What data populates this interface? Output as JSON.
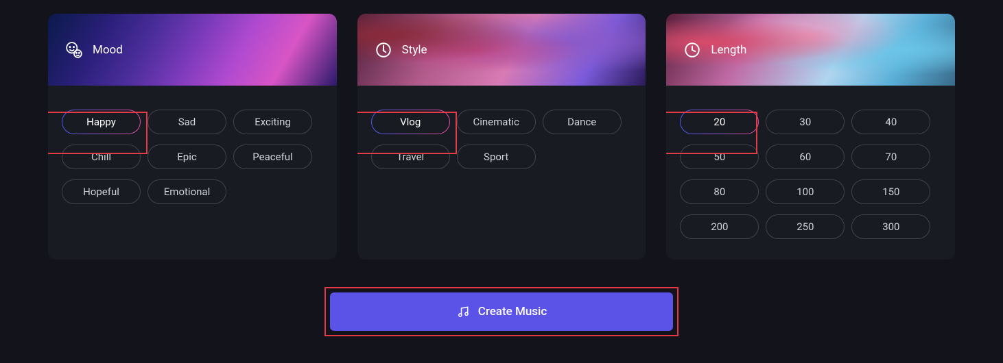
{
  "mood": {
    "title": "Mood",
    "options": [
      {
        "label": "Happy",
        "selected": true
      },
      {
        "label": "Sad",
        "selected": false
      },
      {
        "label": "Exciting",
        "selected": false
      },
      {
        "label": "Chill",
        "selected": false
      },
      {
        "label": "Epic",
        "selected": false
      },
      {
        "label": "Peaceful",
        "selected": false
      },
      {
        "label": "Hopeful",
        "selected": false
      },
      {
        "label": "Emotional",
        "selected": false
      }
    ]
  },
  "style": {
    "title": "Style",
    "options": [
      {
        "label": "Vlog",
        "selected": true
      },
      {
        "label": "Cinematic",
        "selected": false
      },
      {
        "label": "Dance",
        "selected": false
      },
      {
        "label": "Travel",
        "selected": false
      },
      {
        "label": "Sport",
        "selected": false
      }
    ]
  },
  "length": {
    "title": "Length",
    "options": [
      {
        "label": "20",
        "selected": true
      },
      {
        "label": "30",
        "selected": false
      },
      {
        "label": "40",
        "selected": false
      },
      {
        "label": "50",
        "selected": false
      },
      {
        "label": "60",
        "selected": false
      },
      {
        "label": "70",
        "selected": false
      },
      {
        "label": "80",
        "selected": false
      },
      {
        "label": "100",
        "selected": false
      },
      {
        "label": "150",
        "selected": false
      },
      {
        "label": "200",
        "selected": false
      },
      {
        "label": "250",
        "selected": false
      },
      {
        "label": "300",
        "selected": false
      }
    ]
  },
  "create_button": {
    "label": "Create Music"
  },
  "colors": {
    "accent": "#5b52e8",
    "highlight": "#e63946"
  }
}
